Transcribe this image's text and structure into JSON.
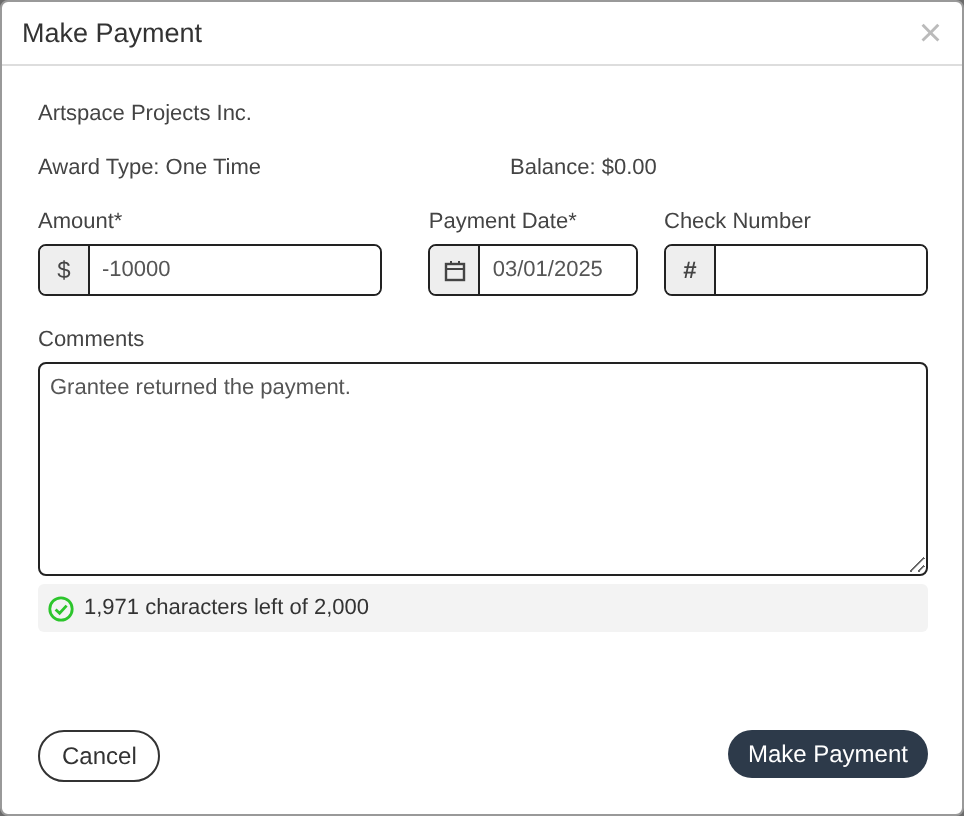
{
  "dialog": {
    "title": "Make Payment",
    "close": "×"
  },
  "grantee": "Artspace Projects Inc.",
  "award_type": "Award Type: One Time",
  "balance": "Balance: $0.00",
  "amount": {
    "label": "Amount*",
    "prefix": "$",
    "value": "-10000"
  },
  "payment_date": {
    "label": "Payment Date*",
    "value": "03/01/2025"
  },
  "check_number": {
    "label": "Check Number",
    "prefix": "#"
  },
  "comments": {
    "label": "Comments",
    "value": "Grantee returned the payment."
  },
  "counter": "1,971 characters left of 2,000",
  "buttons": {
    "cancel": "Cancel",
    "submit": "Make Payment"
  }
}
